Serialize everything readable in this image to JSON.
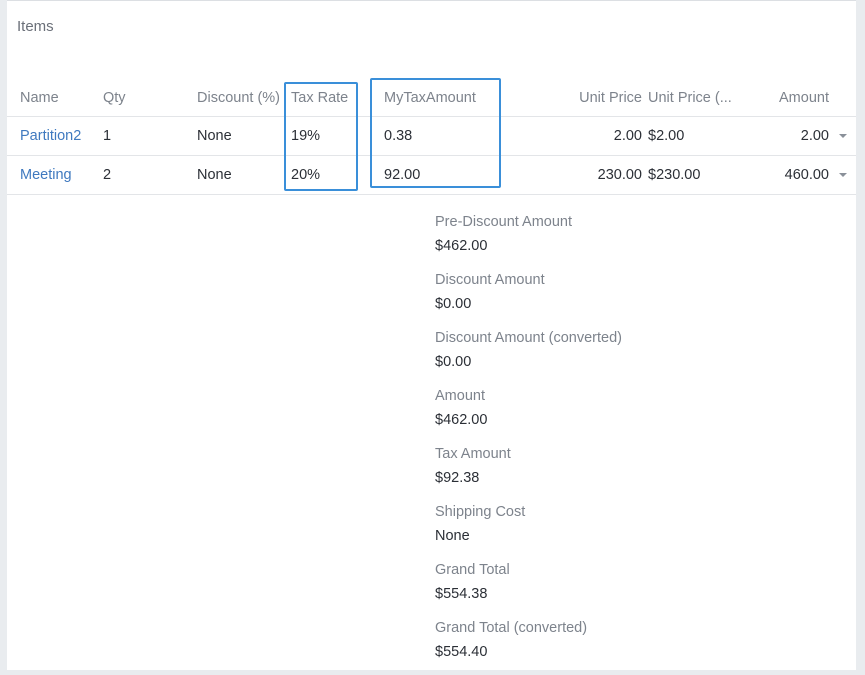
{
  "panel": {
    "title": "Items"
  },
  "table": {
    "headers": {
      "name": "Name",
      "qty": "Qty",
      "discount": "Discount (%)",
      "tax_rate": "Tax Rate",
      "my_tax_amount": "MyTaxAmount",
      "unit_price": "Unit Price",
      "unit_price_converted": "Unit Price (...",
      "amount": "Amount"
    },
    "rows": [
      {
        "name": "Partition2",
        "qty": "1",
        "discount": "None",
        "tax_rate": "19%",
        "my_tax_amount": "0.38",
        "unit_price": "2.00",
        "unit_price_converted": "$2.00",
        "amount": "2.00"
      },
      {
        "name": "Meeting",
        "qty": "2",
        "discount": "None",
        "tax_rate": "20%",
        "my_tax_amount": "92.00",
        "unit_price": "230.00",
        "unit_price_converted": "$230.00",
        "amount": "460.00"
      }
    ]
  },
  "summary": {
    "fields": [
      {
        "label": "Pre-Discount Amount",
        "value": "$462.00"
      },
      {
        "label": "Discount Amount",
        "value": "$0.00"
      },
      {
        "label": "Discount Amount (converted)",
        "value": "$0.00"
      },
      {
        "label": "Amount",
        "value": "$462.00"
      },
      {
        "label": "Tax Amount",
        "value": "$92.38"
      },
      {
        "label": "Shipping Cost",
        "value": "None"
      },
      {
        "label": "Grand Total",
        "value": "$554.38"
      },
      {
        "label": "Grand Total (converted)",
        "value": "$554.40"
      }
    ]
  },
  "icons": {
    "row_menu": "chevron-down-icon"
  },
  "colors": {
    "link": "#3f79bf",
    "highlight": "#3a8fd9"
  }
}
